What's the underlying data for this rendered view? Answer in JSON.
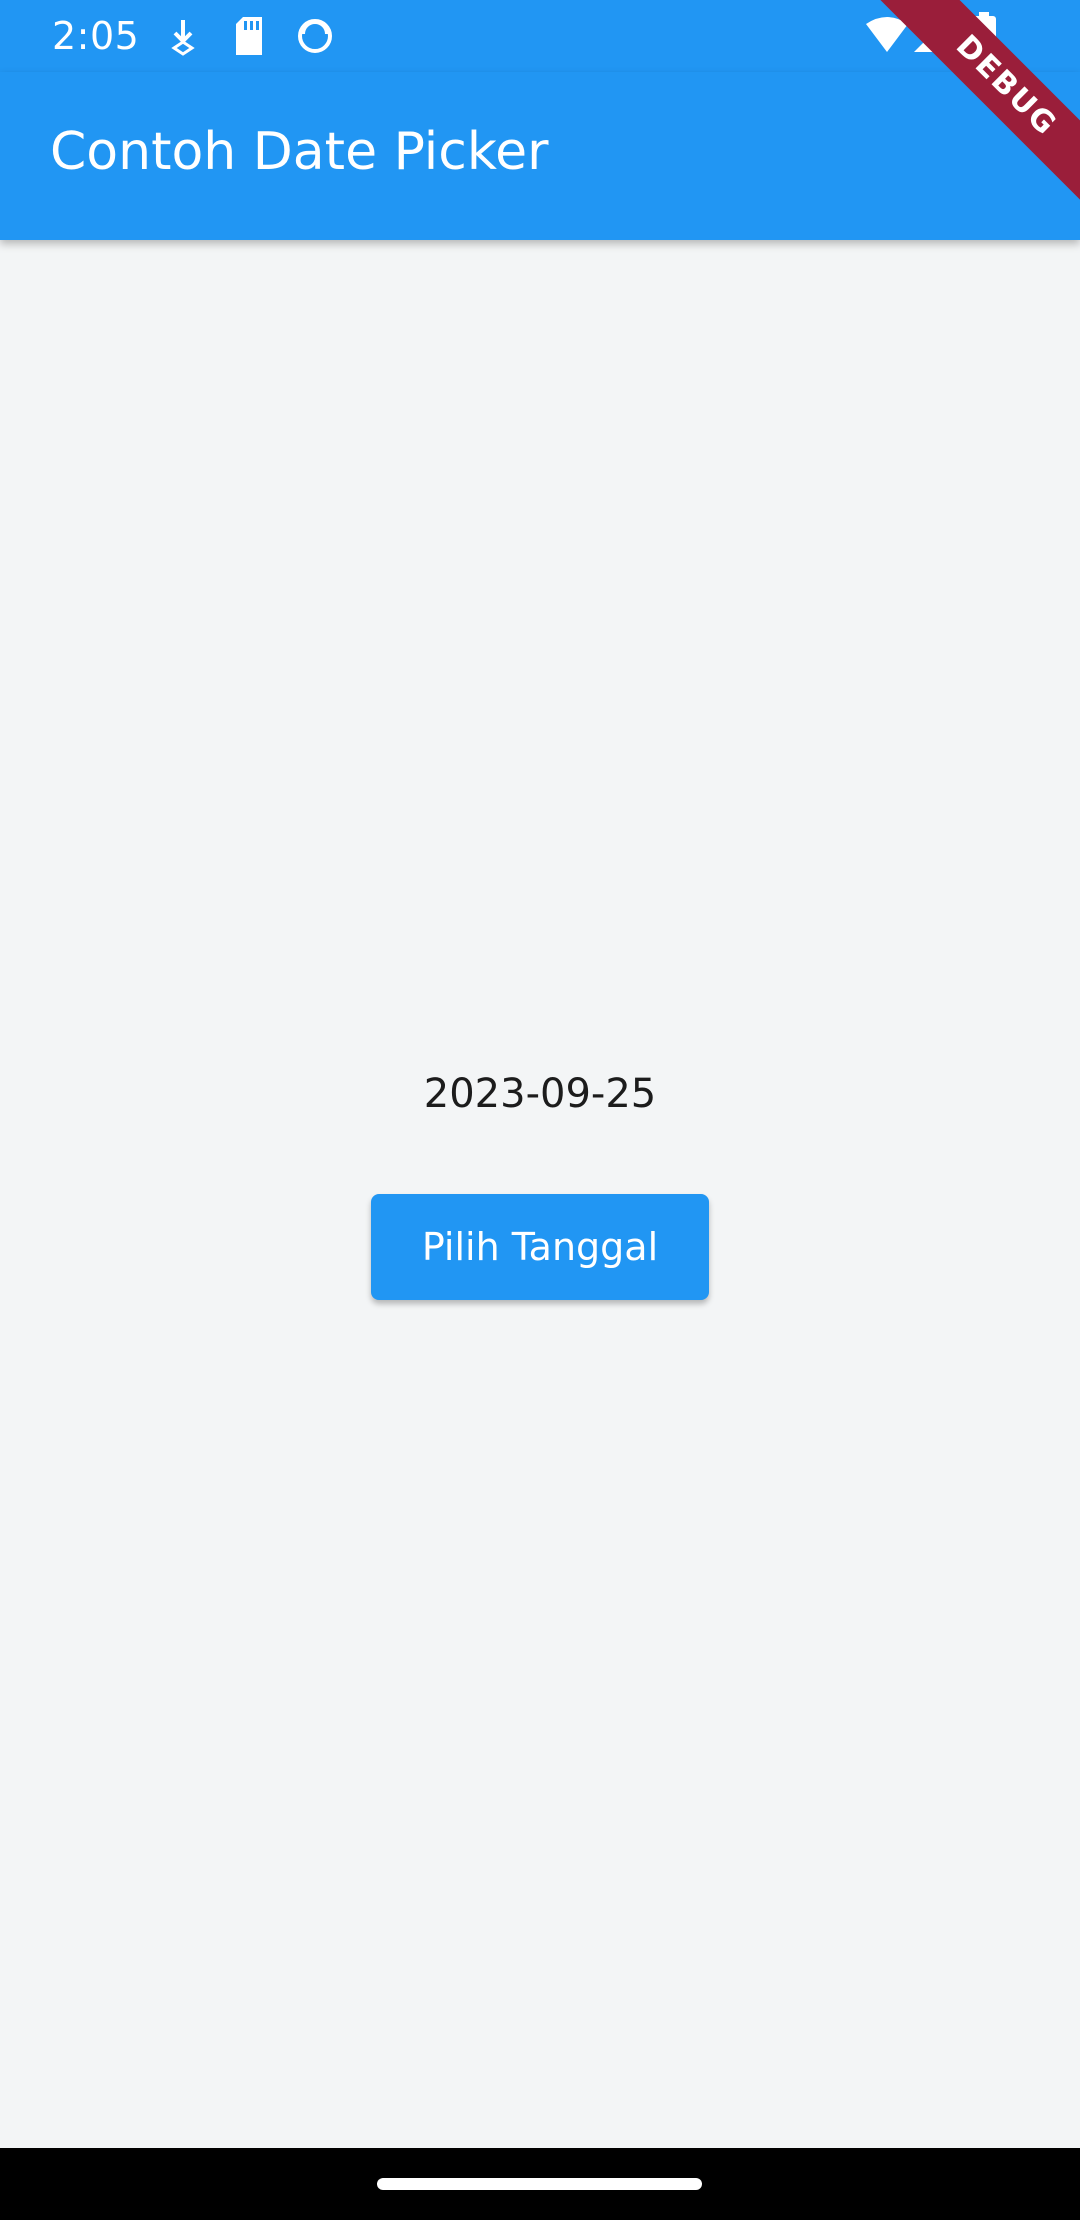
{
  "status_bar": {
    "time": "2:05",
    "left_icons": [
      "download-notification-icon",
      "sd-card-icon",
      "sync-icon"
    ],
    "right_icons": [
      "wifi-icon",
      "cellular-signal-icon",
      "battery-icon"
    ]
  },
  "app_bar": {
    "title": "Contoh Date Picker",
    "color": "#2196f3"
  },
  "debug_banner": {
    "label": "DEBUG",
    "color": "#9a1e3a"
  },
  "main": {
    "selected_date": "2023-09-25",
    "pick_button_label": "Pilih Tanggal",
    "background": "#f3f5f6"
  },
  "nav_bar": {
    "handle": "home-gesture-handle"
  }
}
